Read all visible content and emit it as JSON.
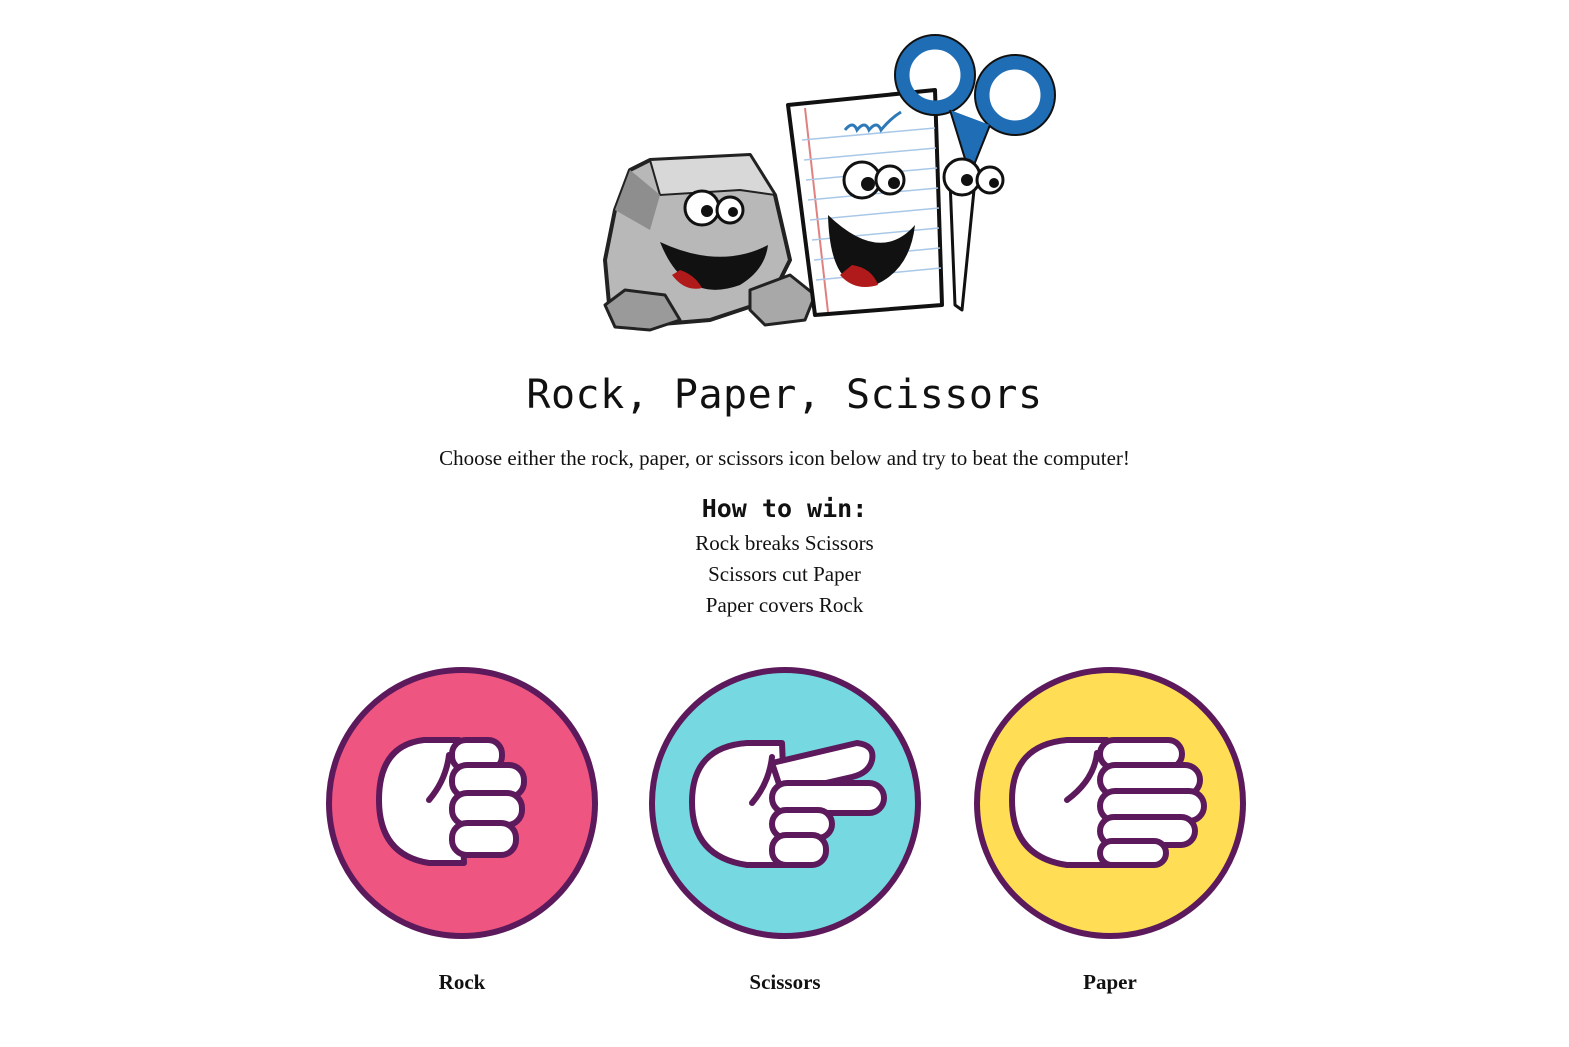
{
  "header": {
    "title": "Rock, Paper, Scissors",
    "instructions": "Choose either the rock, paper, or scissors icon below and try to beat the computer!"
  },
  "how_to_win": {
    "heading": "How to win:",
    "rules": [
      "Rock breaks Scissors",
      "Scissors cut Paper",
      "Paper covers Rock"
    ]
  },
  "choices": [
    {
      "label": "Rock",
      "icon": "fist-icon",
      "color": "#ef5581"
    },
    {
      "label": "Scissors",
      "icon": "scissors-hand-icon",
      "color": "#76d8e0"
    },
    {
      "label": "Paper",
      "icon": "open-hand-icon",
      "color": "#ffdd55"
    }
  ],
  "colors": {
    "outline": "#5c1a5c",
    "scissors_handle": "#1f6db5"
  },
  "hero": {
    "icon": "rock-paper-scissors-cartoon"
  }
}
